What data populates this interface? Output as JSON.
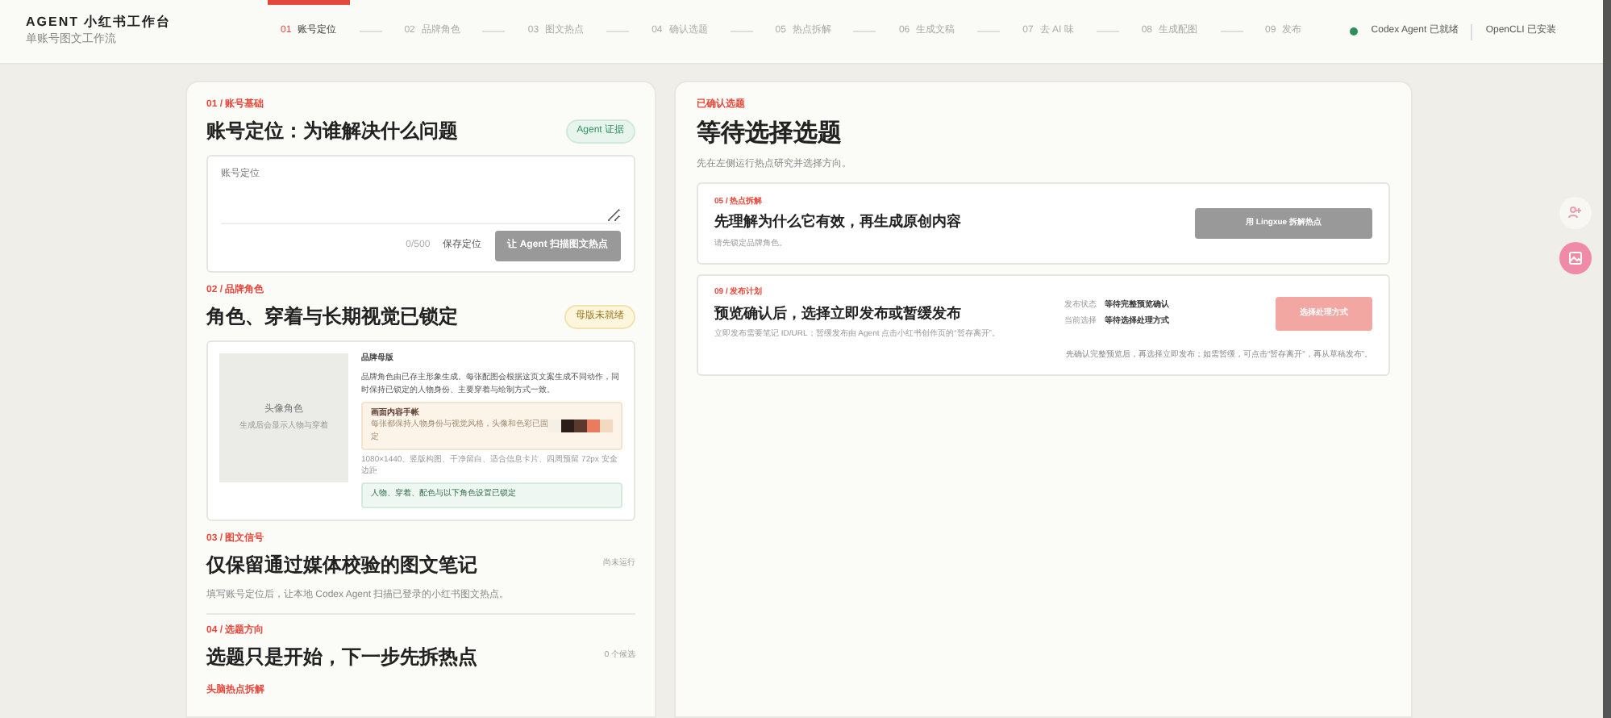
{
  "app": {
    "title": "AGENT 小红书工作台",
    "subtitle": "单账号图文工作流"
  },
  "steps": [
    {
      "number": "01",
      "label": "账号定位",
      "selected": true
    },
    {
      "number": "02",
      "label": "品牌角色",
      "selected": false
    },
    {
      "number": "03",
      "label": "图文热点",
      "selected": false
    },
    {
      "number": "04",
      "label": "确认选题",
      "selected": false
    },
    {
      "number": "05",
      "label": "热点拆解",
      "selected": false
    },
    {
      "number": "06",
      "label": "生成文稿",
      "selected": false
    },
    {
      "number": "07",
      "label": "去 AI 味",
      "selected": false
    },
    {
      "number": "08",
      "label": "生成配图",
      "selected": false
    },
    {
      "number": "09",
      "label": "发布",
      "selected": false
    }
  ],
  "status": [
    {
      "label": "Codex Agent 已就绪",
      "color": "#2f8f5b"
    },
    {
      "label": "OpenCLI 已安装"
    }
  ],
  "positioning": {
    "eyebrow": "01 / 账号基础",
    "title": "账号定位：为谁解决什么问题",
    "badge": "Agent 证据",
    "placeholder": "账号定位",
    "counter": "0/500",
    "save": "保存定位",
    "scan_button": "让 Agent 扫描图文热点"
  },
  "brand": {
    "eyebrow": "02 / 品牌角色",
    "title": "角色、穿着与长期视觉已锁定",
    "badge": "母版未就绪",
    "avatar_title": "头像角色",
    "avatar_hint": "生成后会显示人物与穿着",
    "master_title": "品牌母版",
    "master_text": "品牌角色由已存主形象生成。每张配图会根据这页文案生成不同动作，同时保持已锁定的人物身份、主要穿着与绘制方式一致。",
    "palette_title": "画面内容手帐",
    "palette_hint": "每张都保持人物身份与视觉风格，头像和色彩已固定",
    "swatches": [
      {
        "color": "#f6efe6"
      },
      {
        "color": "#2b1d17"
      },
      {
        "color": "#5a3a2c"
      },
      {
        "color": "#e97c5e"
      },
      {
        "color": "#f3d9c0"
      }
    ],
    "spec": "1080×1440、竖版构图、干净留白、适合信息卡片、四周预留 72px 安全边距",
    "locked": "人物、穿着、配色与以下角色设置已锁定"
  },
  "signals": {
    "eyebrow": "03 / 图文信号",
    "title": "仅保留通过媒体校验的图文笔记",
    "state": "尚未运行",
    "text": "填写账号定位后，让本地 Codex Agent 扫描已登录的小红书图文热点。"
  },
  "topics": {
    "eyebrow": "04 / 选题方向",
    "title": "选题只是开始，下一步先拆热点",
    "count": "0 个候选",
    "next_eyebrow": "头脑热点拆解"
  },
  "selected_topic": {
    "eyebrow": "已确认选题",
    "title": "等待选择选题",
    "text": "先在左侧运行热点研究并选择方向。"
  },
  "breakdown": {
    "eyebrow": "05 / 热点拆解",
    "title": "先理解为什么它有效，再生成原创内容",
    "text": "请先锁定品牌角色。",
    "button": "用 Lingxue 拆解热点",
    "disabled": true
  },
  "publish": {
    "eyebrow": "09 / 发布计划",
    "title": "预览确认后，选择立即发布或暂缓发布",
    "text": "立即发布需要笔记 ID/URL；暂缓发布由 Agent 点击小红书创作页的“暂存离开”。",
    "fields": [
      {
        "key": "发布状态",
        "value": "等待完整预览确认"
      },
      {
        "key": "当前选择",
        "value": "等待选择处理方式"
      }
    ],
    "button": "选择处理方式",
    "note": "先确认完整预览后，再选择立即发布；如需暂缓，可点击“暂存离开”，再从草稿发布”。"
  }
}
